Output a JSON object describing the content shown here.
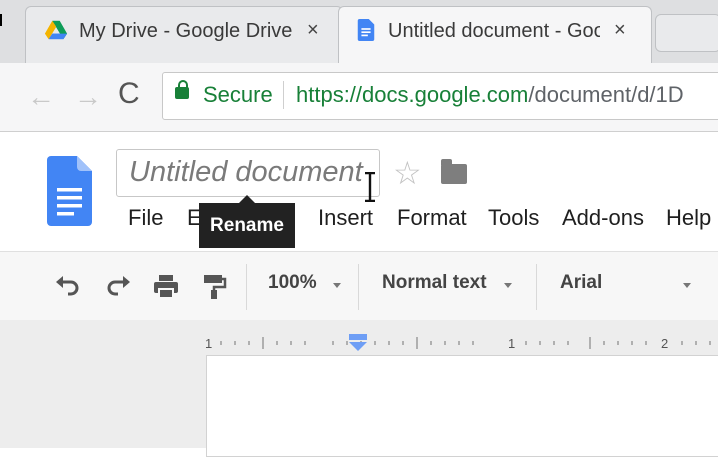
{
  "browser": {
    "tabs": [
      {
        "title": "My Drive - Google Drive",
        "close": "×"
      },
      {
        "title": "Untitled document - Goo",
        "close": "×"
      }
    ],
    "secure_label": "Secure",
    "url_host": "https://docs.google.com",
    "url_path": "/document/d/1D",
    "back_icon": "←",
    "forward_icon": "→",
    "reload_icon": "C"
  },
  "docs": {
    "title": "Untitled document",
    "star": "☆",
    "tooltip": "Rename",
    "menu": [
      "File",
      "E",
      "Insert",
      "Format",
      "Tools",
      "Add-ons",
      "Help"
    ]
  },
  "toolbar": {
    "zoom": "100%",
    "style": "Normal text",
    "font": "Arial"
  },
  "ruler": {
    "labels": [
      "1",
      "1",
      "2"
    ]
  },
  "colors": {
    "secure_green": "#188038",
    "docs_blue": "#4285f4",
    "tooltip_bg": "#222222"
  }
}
